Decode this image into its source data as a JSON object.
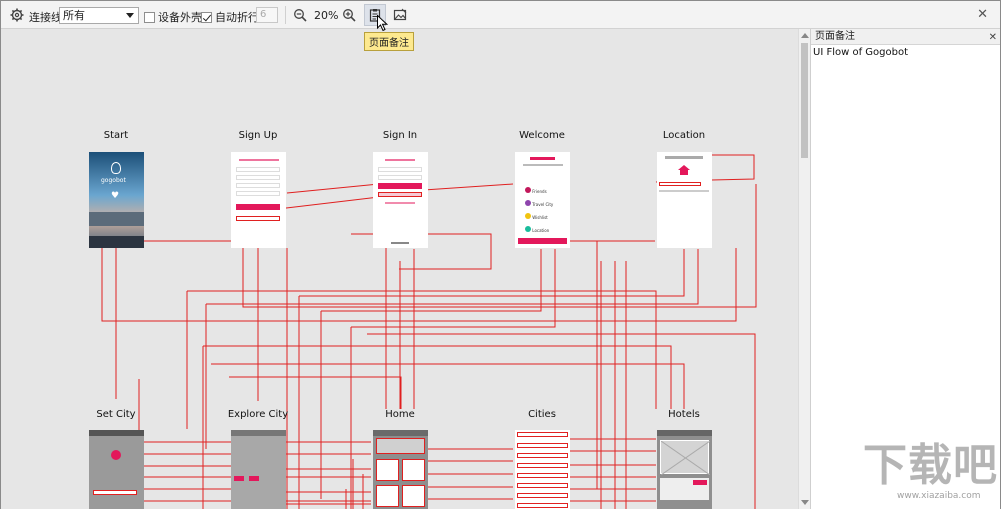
{
  "toolbar": {
    "connect_label": "连接线",
    "connect_value": "所有",
    "device_shell_label": "设备外壳",
    "device_shell_checked": false,
    "auto_wrap_label": "自动折行",
    "auto_wrap_checked": true,
    "wrap_count": "6",
    "zoom": "20%",
    "tooltip": "页面备注"
  },
  "notes": {
    "header": "页面备注",
    "body": "UI Flow of Gogobot"
  },
  "screens": [
    {
      "id": "start",
      "title": "Start"
    },
    {
      "id": "signup",
      "title": "Sign Up"
    },
    {
      "id": "signin",
      "title": "Sign In"
    },
    {
      "id": "welcome",
      "title": "Welcome"
    },
    {
      "id": "location",
      "title": "Location"
    },
    {
      "id": "setcity",
      "title": "Set City"
    },
    {
      "id": "explorecity",
      "title": "Explore City"
    },
    {
      "id": "home",
      "title": "Home"
    },
    {
      "id": "cities",
      "title": "Cities"
    },
    {
      "id": "hotels",
      "title": "Hotels"
    }
  ],
  "welcome_items": [
    "Friends",
    "Travel City",
    "Wishlist",
    "Location"
  ],
  "watermark": {
    "big": "下载吧",
    "small": "www.xiazaiba.com"
  },
  "colors": {
    "accent": "#e3185b",
    "line": "#e02020",
    "canvas": "#e6e6e6",
    "tooltip": "#fde98f"
  }
}
